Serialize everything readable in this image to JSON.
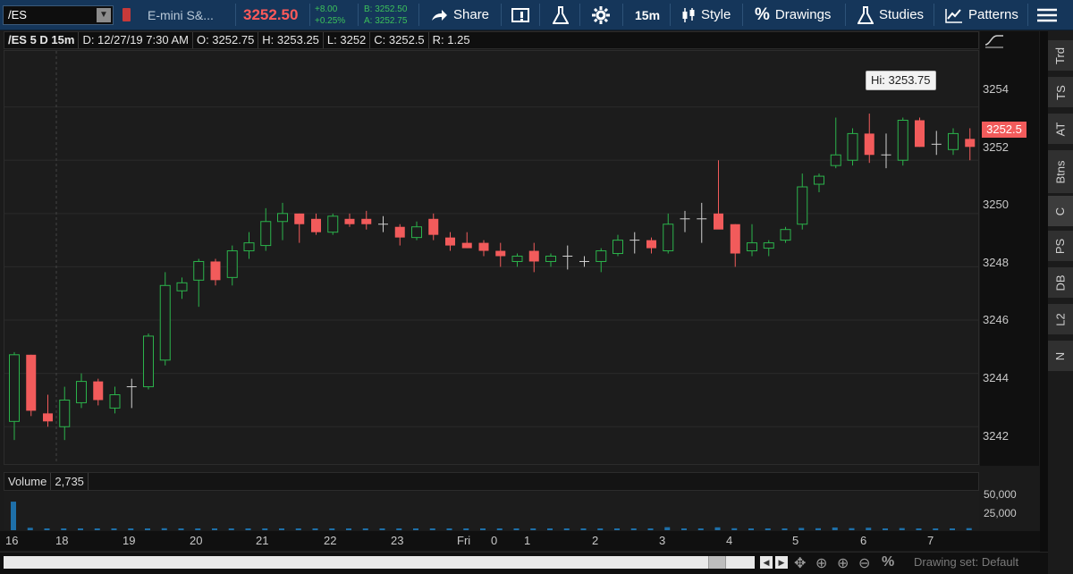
{
  "toolbar": {
    "symbol": "/ES",
    "description": "E-mini S&...",
    "last_price": "3252.50",
    "net_change": "+8.00",
    "pct_change": "+0.25%",
    "bid": "B: 3252.50",
    "ask": "A: 3252.75",
    "share_label": "Share",
    "timeframe_label": "15m",
    "style_label": "Style",
    "drawings_label": "Drawings",
    "studies_label": "Studies",
    "patterns_label": "Patterns"
  },
  "info_bar": {
    "symbol_period": "/ES 5 D 15m",
    "date": "D: 12/27/19 7:30 AM",
    "open": "O: 3252.75",
    "high": "H: 3253.25",
    "low": "L: 3252",
    "close": "C: 3252.5",
    "range": "R: 1.25"
  },
  "price_axis": {
    "ticks": [
      "3254",
      "3252",
      "3250",
      "3248",
      "3246",
      "3244",
      "3242"
    ],
    "last_tag": "3252.5",
    "hi_label": "Hi: 3253.75"
  },
  "sidebar": {
    "tabs": [
      "Trd",
      "TS",
      "AT",
      "Btns",
      "C",
      "PS",
      "DB",
      "L2",
      "N"
    ]
  },
  "volume": {
    "label": "Volume",
    "value": "2,735",
    "ticks": [
      "50,000",
      "25,000"
    ]
  },
  "time_axis": {
    "labels": [
      "16",
      "18",
      "19",
      "20",
      "21",
      "22",
      "23",
      "Fri",
      "0",
      "1",
      "2",
      "3",
      "4",
      "5",
      "6",
      "7"
    ]
  },
  "bottom_bar": {
    "drawing_set": "Drawing set: Default"
  },
  "colors": {
    "up": "#2bb34b",
    "down": "#f25b5b",
    "doji": "#d0d0d0",
    "toolbar_bg": "#15365a"
  },
  "chart_data": {
    "type": "candlestick",
    "title": "/ES 5 D 15m",
    "ylim": [
      3240.6,
      3256.1
    ],
    "candles": [
      {
        "o": 3242.2,
        "h": 3244.8,
        "l": 3241.5,
        "c": 3244.7
      },
      {
        "o": 3244.7,
        "h": 3244.7,
        "l": 3242.4,
        "c": 3242.6
      },
      {
        "o": 3242.5,
        "h": 3243.2,
        "l": 3242.0,
        "c": 3242.2
      },
      {
        "o": 3242.0,
        "h": 3243.5,
        "l": 3241.5,
        "c": 3243.0
      },
      {
        "o": 3242.9,
        "h": 3244.0,
        "l": 3242.7,
        "c": 3243.7
      },
      {
        "o": 3243.7,
        "h": 3243.8,
        "l": 3242.8,
        "c": 3243.0
      },
      {
        "o": 3242.7,
        "h": 3243.5,
        "l": 3242.5,
        "c": 3243.2
      },
      {
        "o": 3243.5,
        "h": 3243.8,
        "l": 3242.7,
        "c": 3243.5
      },
      {
        "o": 3243.5,
        "h": 3245.5,
        "l": 3243.4,
        "c": 3245.4
      },
      {
        "o": 3244.5,
        "h": 3247.8,
        "l": 3244.3,
        "c": 3247.3
      },
      {
        "o": 3247.1,
        "h": 3247.6,
        "l": 3246.8,
        "c": 3247.4
      },
      {
        "o": 3247.5,
        "h": 3248.3,
        "l": 3246.5,
        "c": 3248.2
      },
      {
        "o": 3248.2,
        "h": 3248.3,
        "l": 3247.3,
        "c": 3247.5
      },
      {
        "o": 3247.6,
        "h": 3248.8,
        "l": 3247.3,
        "c": 3248.6
      },
      {
        "o": 3248.6,
        "h": 3249.3,
        "l": 3248.3,
        "c": 3248.9
      },
      {
        "o": 3248.8,
        "h": 3250.2,
        "l": 3248.6,
        "c": 3249.7
      },
      {
        "o": 3249.7,
        "h": 3250.4,
        "l": 3249.0,
        "c": 3250.0
      },
      {
        "o": 3250.0,
        "h": 3250.0,
        "l": 3248.9,
        "c": 3249.6
      },
      {
        "o": 3249.8,
        "h": 3250.0,
        "l": 3249.2,
        "c": 3249.3
      },
      {
        "o": 3249.3,
        "h": 3250.0,
        "l": 3249.2,
        "c": 3249.9
      },
      {
        "o": 3249.8,
        "h": 3250.0,
        "l": 3249.5,
        "c": 3249.6
      },
      {
        "o": 3249.8,
        "h": 3250.1,
        "l": 3249.4,
        "c": 3249.6
      },
      {
        "o": 3249.6,
        "h": 3249.9,
        "l": 3249.3,
        "c": 3249.6
      },
      {
        "o": 3249.5,
        "h": 3249.6,
        "l": 3248.8,
        "c": 3249.1
      },
      {
        "o": 3249.1,
        "h": 3249.7,
        "l": 3249.0,
        "c": 3249.5
      },
      {
        "o": 3249.8,
        "h": 3250.0,
        "l": 3249.0,
        "c": 3249.2
      },
      {
        "o": 3249.1,
        "h": 3249.3,
        "l": 3248.6,
        "c": 3248.8
      },
      {
        "o": 3248.9,
        "h": 3249.3,
        "l": 3248.7,
        "c": 3248.7
      },
      {
        "o": 3248.9,
        "h": 3249.0,
        "l": 3248.4,
        "c": 3248.6
      },
      {
        "o": 3248.6,
        "h": 3248.9,
        "l": 3248.0,
        "c": 3248.4
      },
      {
        "o": 3248.2,
        "h": 3248.5,
        "l": 3248.0,
        "c": 3248.4
      },
      {
        "o": 3248.6,
        "h": 3248.9,
        "l": 3247.8,
        "c": 3248.2
      },
      {
        "o": 3248.2,
        "h": 3248.5,
        "l": 3248.0,
        "c": 3248.4
      },
      {
        "o": 3248.4,
        "h": 3248.8,
        "l": 3247.9,
        "c": 3248.4
      },
      {
        "o": 3248.2,
        "h": 3248.4,
        "l": 3248.0,
        "c": 3248.2
      },
      {
        "o": 3248.2,
        "h": 3248.7,
        "l": 3247.8,
        "c": 3248.6
      },
      {
        "o": 3248.5,
        "h": 3249.2,
        "l": 3248.4,
        "c": 3249.0
      },
      {
        "o": 3249.0,
        "h": 3249.3,
        "l": 3248.5,
        "c": 3249.0
      },
      {
        "o": 3249.0,
        "h": 3249.1,
        "l": 3248.5,
        "c": 3248.7
      },
      {
        "o": 3248.6,
        "h": 3250.0,
        "l": 3248.5,
        "c": 3249.6
      },
      {
        "o": 3249.8,
        "h": 3250.1,
        "l": 3249.3,
        "c": 3249.8
      },
      {
        "o": 3249.8,
        "h": 3250.4,
        "l": 3248.9,
        "c": 3249.8
      },
      {
        "o": 3250.0,
        "h": 3252.0,
        "l": 3249.5,
        "c": 3249.4
      },
      {
        "o": 3249.6,
        "h": 3249.6,
        "l": 3248.0,
        "c": 3248.5
      },
      {
        "o": 3248.6,
        "h": 3249.6,
        "l": 3248.4,
        "c": 3248.9
      },
      {
        "o": 3248.7,
        "h": 3249.0,
        "l": 3248.4,
        "c": 3248.9
      },
      {
        "o": 3249.0,
        "h": 3249.5,
        "l": 3248.9,
        "c": 3249.4
      },
      {
        "o": 3249.6,
        "h": 3251.5,
        "l": 3249.4,
        "c": 3251.0
      },
      {
        "o": 3251.1,
        "h": 3251.5,
        "l": 3250.8,
        "c": 3251.4
      },
      {
        "o": 3251.8,
        "h": 3253.6,
        "l": 3251.7,
        "c": 3252.2
      },
      {
        "o": 3252.0,
        "h": 3253.2,
        "l": 3251.8,
        "c": 3253.0
      },
      {
        "o": 3253.0,
        "h": 3253.75,
        "l": 3251.9,
        "c": 3252.2
      },
      {
        "o": 3252.2,
        "h": 3253.0,
        "l": 3251.7,
        "c": 3252.2
      },
      {
        "o": 3252.0,
        "h": 3253.6,
        "l": 3251.8,
        "c": 3253.5
      },
      {
        "o": 3253.5,
        "h": 3253.6,
        "l": 3252.5,
        "c": 3252.5
      },
      {
        "o": 3252.6,
        "h": 3253.1,
        "l": 3252.2,
        "c": 3252.6
      },
      {
        "o": 3252.4,
        "h": 3253.2,
        "l": 3252.2,
        "c": 3253.0
      },
      {
        "o": 3252.8,
        "h": 3253.2,
        "l": 3252.0,
        "c": 3252.5
      }
    ],
    "volume": [
      38000,
      3200,
      1800,
      1500,
      1200,
      1100,
      1300,
      1000,
      1400,
      2600,
      1700,
      1900,
      1800,
      1600,
      1500,
      2000,
      1600,
      1300,
      1200,
      1100,
      1000,
      900,
      1000,
      900,
      800,
      1000,
      900,
      800,
      900,
      1000,
      800,
      900,
      800,
      900,
      800,
      900,
      1300,
      1000,
      1200,
      4000,
      1500,
      1400,
      3800,
      2600,
      1500,
      1200,
      1300,
      3000,
      2600,
      3600,
      2700,
      3300,
      2300,
      2800,
      2000,
      1900,
      1800,
      2735
    ]
  }
}
